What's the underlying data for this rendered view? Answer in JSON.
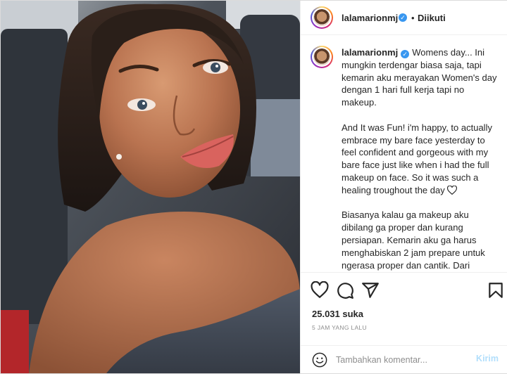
{
  "post": {
    "username": "lalamarionmj",
    "follow_status": "Diikuti",
    "separator": "•"
  },
  "caption": {
    "username": "lalamarionmj",
    "paragraphs": [
      "Womens day... Ini mungkin terdengar biasa saja, tapi kemarin aku merayakan Women's day dengan 1 hari full kerja tapi no makeup.",
      "And It was Fun! i'm happy, to actually embrace my bare face yesterday to feel confident and gorgeous with my bare face just like when i had the full makeup on face. So it was such a healing troughout the day",
      "Biasanya kalau ga makeup aku dibilang ga proper dan kurang persiapan. Kemarin aku ga harus menghabiskan 2 jam prepare untuk ngerasa proper dan cantik. Dari jerawat sampai bekas jerawat, ternyata nyaman untuk di pamerkan as long as"
    ]
  },
  "stats": {
    "likes": "25.031 suka",
    "time_ago": "5 JAM YANG LALU"
  },
  "comment": {
    "placeholder": "Tambahkan komentar...",
    "send_label": "Kirim"
  },
  "icons": {
    "like": "heart-icon",
    "comment": "comment-icon",
    "share": "send-icon",
    "save": "bookmark-icon",
    "emoji": "emoji-icon",
    "verified": "verified-badge-icon",
    "more": "more-options-icon"
  },
  "colors": {
    "verified": "#3897f0",
    "send_disabled": "#b2dffc",
    "muted": "#8e8e8e"
  }
}
